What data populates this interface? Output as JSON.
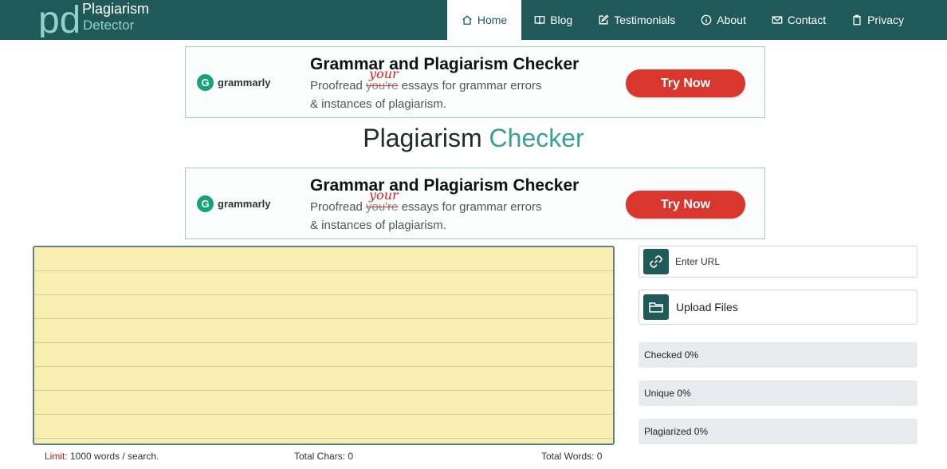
{
  "brand": {
    "logo_letters": "pd",
    "name_line1": "Plagiarism",
    "name_line2": "Detector"
  },
  "nav": {
    "items": [
      {
        "label": "Home",
        "icon": "home-icon",
        "active": true
      },
      {
        "label": "Blog",
        "icon": "book-icon",
        "active": false
      },
      {
        "label": "Testimonials",
        "icon": "edit-icon",
        "active": false
      },
      {
        "label": "About",
        "icon": "info-icon",
        "active": false
      },
      {
        "label": "Contact",
        "icon": "mail-icon",
        "active": false
      },
      {
        "label": "Privacy",
        "icon": "clipboard-icon",
        "active": false
      }
    ]
  },
  "ad": {
    "brand_initial": "G",
    "brand_word": "grammarly",
    "title": "Grammar and Plagiarism Checker",
    "line1_prefix": "Proofread ",
    "line1_struck": "you're",
    "line1_correction": "your",
    "line1_suffix": " essays for grammar errors",
    "line2": "& instances of plagiarism.",
    "cta": "Try Now"
  },
  "heading": {
    "part1": "Plagiarism ",
    "part2": "Checker"
  },
  "editor": {
    "value": "",
    "limit_label": "Limit:",
    "limit_text": " 1000 words / search.",
    "total_chars": "Total Chars: 0",
    "total_words": "Total Words: 0"
  },
  "sidebar": {
    "url_placeholder": "Enter URL",
    "upload_label": "Upload Files",
    "checked": "Checked 0%",
    "unique": "Unique 0%",
    "plagiarized": "Plagiarized 0%"
  },
  "colors": {
    "header": "#1f5a58",
    "accent": "#3aa097",
    "notepad": "#f7eeb0",
    "cta": "#d9372e"
  }
}
